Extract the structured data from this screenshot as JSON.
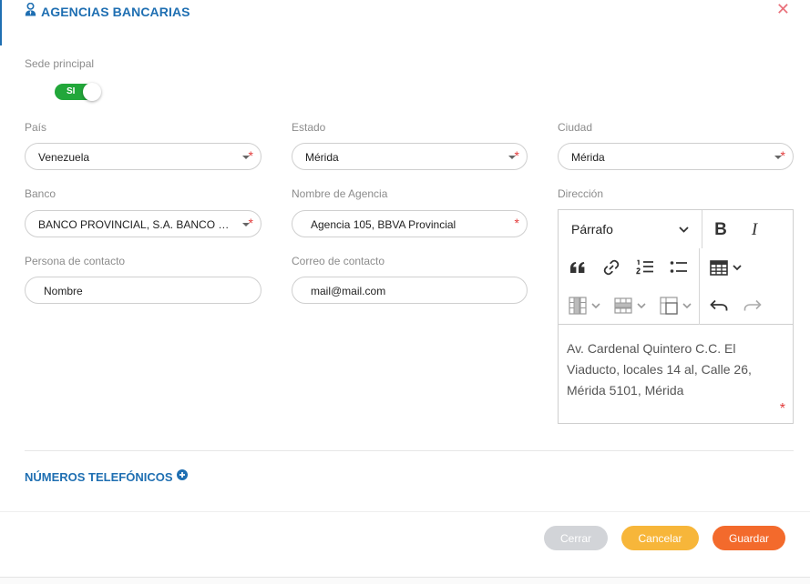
{
  "dialog": {
    "title": "AGENCIAS BANCARIAS",
    "title_icon": "user-tie-icon",
    "close_icon": "close-icon",
    "close_glyph": "✕"
  },
  "sede": {
    "label": "Sede principal",
    "toggle_text": "SI",
    "on": true
  },
  "fields": {
    "pais": {
      "label": "País",
      "value": "Venezuela"
    },
    "estado": {
      "label": "Estado",
      "value": "Mérida"
    },
    "ciudad": {
      "label": "Ciudad",
      "value": "Mérida"
    },
    "banco": {
      "label": "Banco",
      "value": "BANCO PROVINCIAL, S.A. BANCO UNIVERSAL"
    },
    "agencia": {
      "label": "Nombre de Agencia",
      "value": "Agencia 105, BBVA Provincial"
    },
    "direccion": {
      "label": "Dirección"
    },
    "contacto": {
      "label": "Persona de contacto",
      "value": "Nombre"
    },
    "correo": {
      "label": "Correo de contacto",
      "value": "mail@mail.com"
    }
  },
  "required_mark": "*",
  "editor": {
    "paragraph_select": "Párrafo",
    "content": "Av. Cardenal Quintero C.C. El Viaducto, locales 14 al, Calle 26, Mérida 5101, Mérida",
    "bold_glyph": "B",
    "italic_glyph": "I"
  },
  "phones": {
    "label": "NÚMEROS TELEFÓNICOS",
    "icon": "plus-circle-icon"
  },
  "buttons": {
    "cerrar": "Cerrar",
    "cancelar": "Cancelar",
    "guardar": "Guardar"
  },
  "colors": {
    "brand_blue": "#1f6fb2",
    "toggle_green": "#22a73a",
    "required_red": "#e23b3b",
    "close_pink": "#e9707a",
    "cerrar_gray": "#d2d4d8",
    "cancelar_orange": "#f7b63a",
    "guardar_orange": "#f36a2c"
  }
}
